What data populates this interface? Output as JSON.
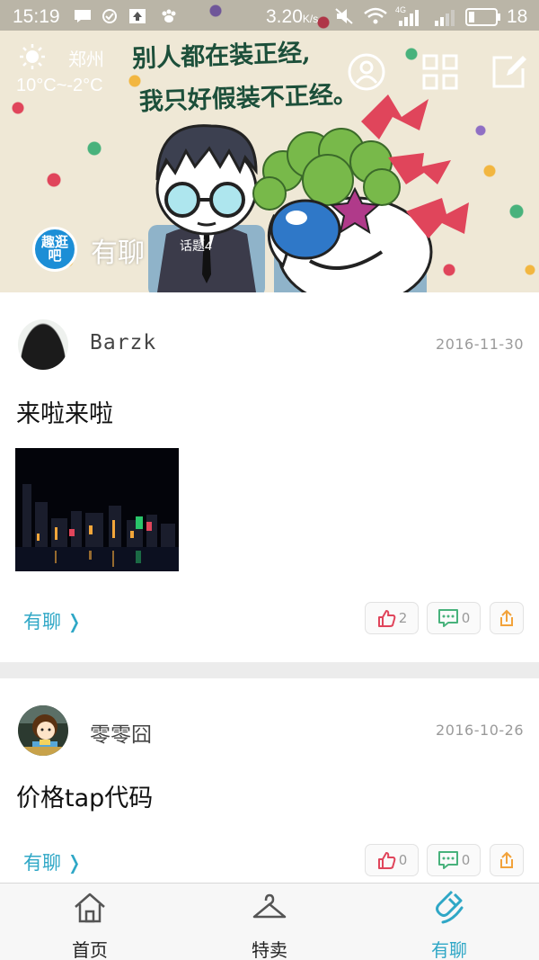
{
  "status_bar": {
    "time": "15:19",
    "speed": "3.20",
    "speed_unit": "K/s",
    "network": "4G",
    "battery": "18"
  },
  "weather": {
    "city": "郑州",
    "temperature": "10°C~-2°C",
    "icon": "sun-icon"
  },
  "banner": {
    "slogan_line1": "别人都在装正经,",
    "slogan_line2": "我只好假装不正经。"
  },
  "circle": {
    "logo_text": "趣逛吧",
    "name": "有聊",
    "topic_tag": "话题4"
  },
  "posts": [
    {
      "author": "Barzk",
      "date": "2016-11-30",
      "content": "来啦来啦",
      "has_image": true,
      "circle_link": "有聊 ❭",
      "likes": "2",
      "comments": "0"
    },
    {
      "author": "零零囧",
      "date": "2016-10-26",
      "content": "价格tap代码",
      "has_image": false,
      "circle_link": "有聊 ❭",
      "likes": "0",
      "comments": "0"
    }
  ],
  "bottom_nav": {
    "items": [
      {
        "label": "首页",
        "icon": "home-icon",
        "active": false
      },
      {
        "label": "特卖",
        "icon": "hanger-icon",
        "active": false
      },
      {
        "label": "有聊",
        "icon": "magnet-icon",
        "active": true
      }
    ]
  },
  "colors": {
    "accent": "#2fa7c6",
    "like": "#e0455b",
    "comment": "#48b27c",
    "share": "#f2a23a"
  }
}
